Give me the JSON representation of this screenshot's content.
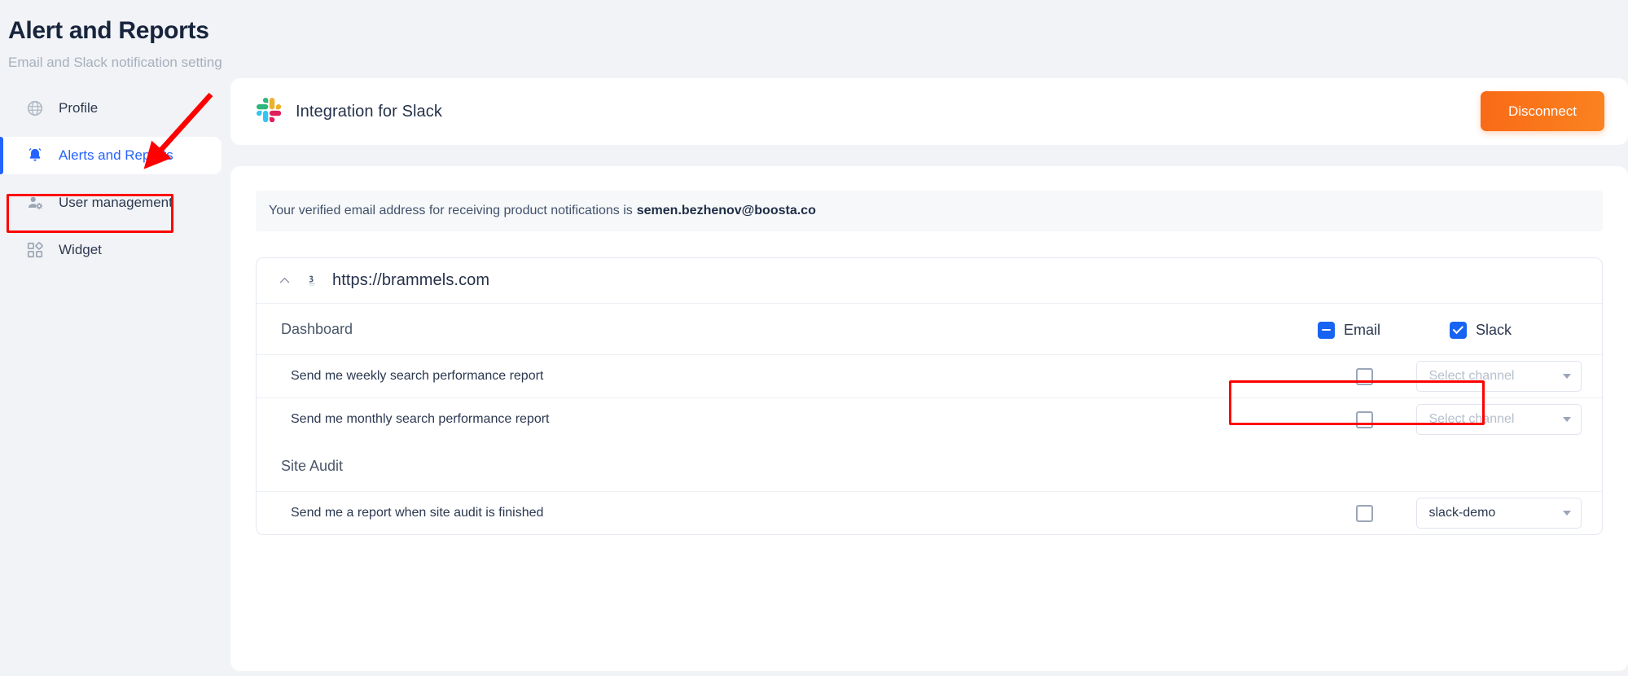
{
  "page": {
    "title": "Alert and Reports",
    "subtitle": "Email and Slack notification setting"
  },
  "sidebar": {
    "items": [
      {
        "label": "Profile",
        "icon": "globe-icon",
        "active": false
      },
      {
        "label": "Alerts and Reports",
        "icon": "bell-icon",
        "active": true
      },
      {
        "label": "User management",
        "icon": "user-gear-icon",
        "active": false
      },
      {
        "label": "Widget",
        "icon": "widget-grid-icon",
        "active": false
      }
    ]
  },
  "integration": {
    "title": "Integration for Slack",
    "logo_icon": "slack-logo-icon",
    "disconnect_label": "Disconnect",
    "disconnect_color": "#f97316"
  },
  "notice": {
    "text": "Your verified email address for receiving product notifications is",
    "email": "semen.bezhenov@boosta.co"
  },
  "site": {
    "url": "https://brammels.com",
    "collapse_icon": "chevron-up-icon",
    "favicon": "site-favicon"
  },
  "columns": {
    "email": {
      "label": "Email",
      "state": "indeterminate"
    },
    "slack": {
      "label": "Slack",
      "state": "checked"
    }
  },
  "sections": [
    {
      "title": "Dashboard",
      "rows": [
        {
          "label": "Send me weekly search performance report",
          "email_checked": false,
          "channel_value": "Select channel",
          "channel_placeholder": true
        },
        {
          "label": "Send me monthly search performance report",
          "email_checked": false,
          "channel_value": "Select channel",
          "channel_placeholder": true
        }
      ]
    },
    {
      "title": "Site Audit",
      "rows": [
        {
          "label": "Send me a report when site audit is finished",
          "email_checked": false,
          "channel_value": "slack-demo",
          "channel_placeholder": false
        }
      ]
    }
  ],
  "colors": {
    "accent": "#2563ff",
    "checkbox": "#1863f3",
    "annotation": "#ff0000",
    "title": "#18243c"
  }
}
